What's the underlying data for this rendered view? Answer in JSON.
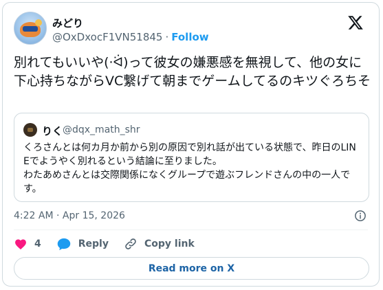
{
  "author": {
    "name": "みどり",
    "handle": "@OxDxocF1VN51845",
    "separator": "·",
    "follow_label": "Follow"
  },
  "tweet": {
    "text": "別れてもいいや(·ᐛ)って彼女の嫌悪感を無視して、他の女に下心持ちながらVC繋げて朝までゲームしてるのキツぐろちそ"
  },
  "quoted": {
    "name": "りく",
    "handle": "@dqx_math_shr",
    "text_line1": "くろさんとは何カ月か前から別の原因で別れ話が出ている状態で、昨日のLINEでようやく別れるという結論に至りました。",
    "text_line2": "わたあめさんとは交際関係になくグループで遊ぶフレンドさんの中の一人です。"
  },
  "meta": {
    "timestamp": "4:22 AM · Apr 15, 2026"
  },
  "actions": {
    "like_count": "4",
    "reply_label": "Reply",
    "copy_link_label": "Copy link"
  },
  "read_more_label": "Read more on X",
  "icons": {
    "x_logo": "x-logo-icon",
    "info": "info-icon",
    "heart": "heart-icon",
    "reply": "reply-icon",
    "link": "link-icon"
  },
  "colors": {
    "accent": "#1d9bf0",
    "like": "#f91880",
    "muted": "#536471"
  }
}
